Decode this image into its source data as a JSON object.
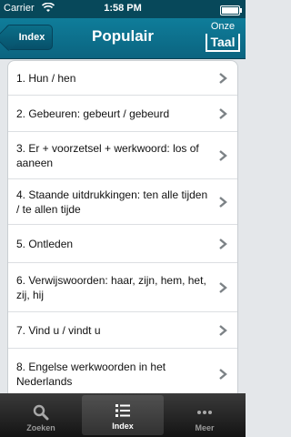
{
  "status_bar": {
    "carrier": "Carrier",
    "time": "1:58 PM"
  },
  "nav": {
    "back_label": "Index",
    "title": "Populair",
    "logo_top": "Onze",
    "logo_bottom": "Taal"
  },
  "items": [
    "1. Hun / hen",
    "2. Gebeuren: gebeurt / gebeurd",
    "3. Er + voorzetsel + werkwoord: los of aaneen",
    "4. Staande uitdrukkingen: ten alle tijden / te allen tijde",
    "5. Ontleden",
    "6. Verwijswoorden: haar, zijn, hem, het, zij, hij",
    "7. Vind u / vindt u",
    "8. Engelse werkwoorden in het Nederlands"
  ],
  "tabs": [
    {
      "label": "Zoeken",
      "icon": "search-icon",
      "selected": false
    },
    {
      "label": "Index",
      "icon": "list-icon",
      "selected": true
    },
    {
      "label": "Meer",
      "icon": "more-icon",
      "selected": false
    }
  ],
  "colors": {
    "nav": "#0f7d9a",
    "status": "#07485a",
    "tabbar": "#1e1e1e",
    "chevron": "#7c8286"
  }
}
